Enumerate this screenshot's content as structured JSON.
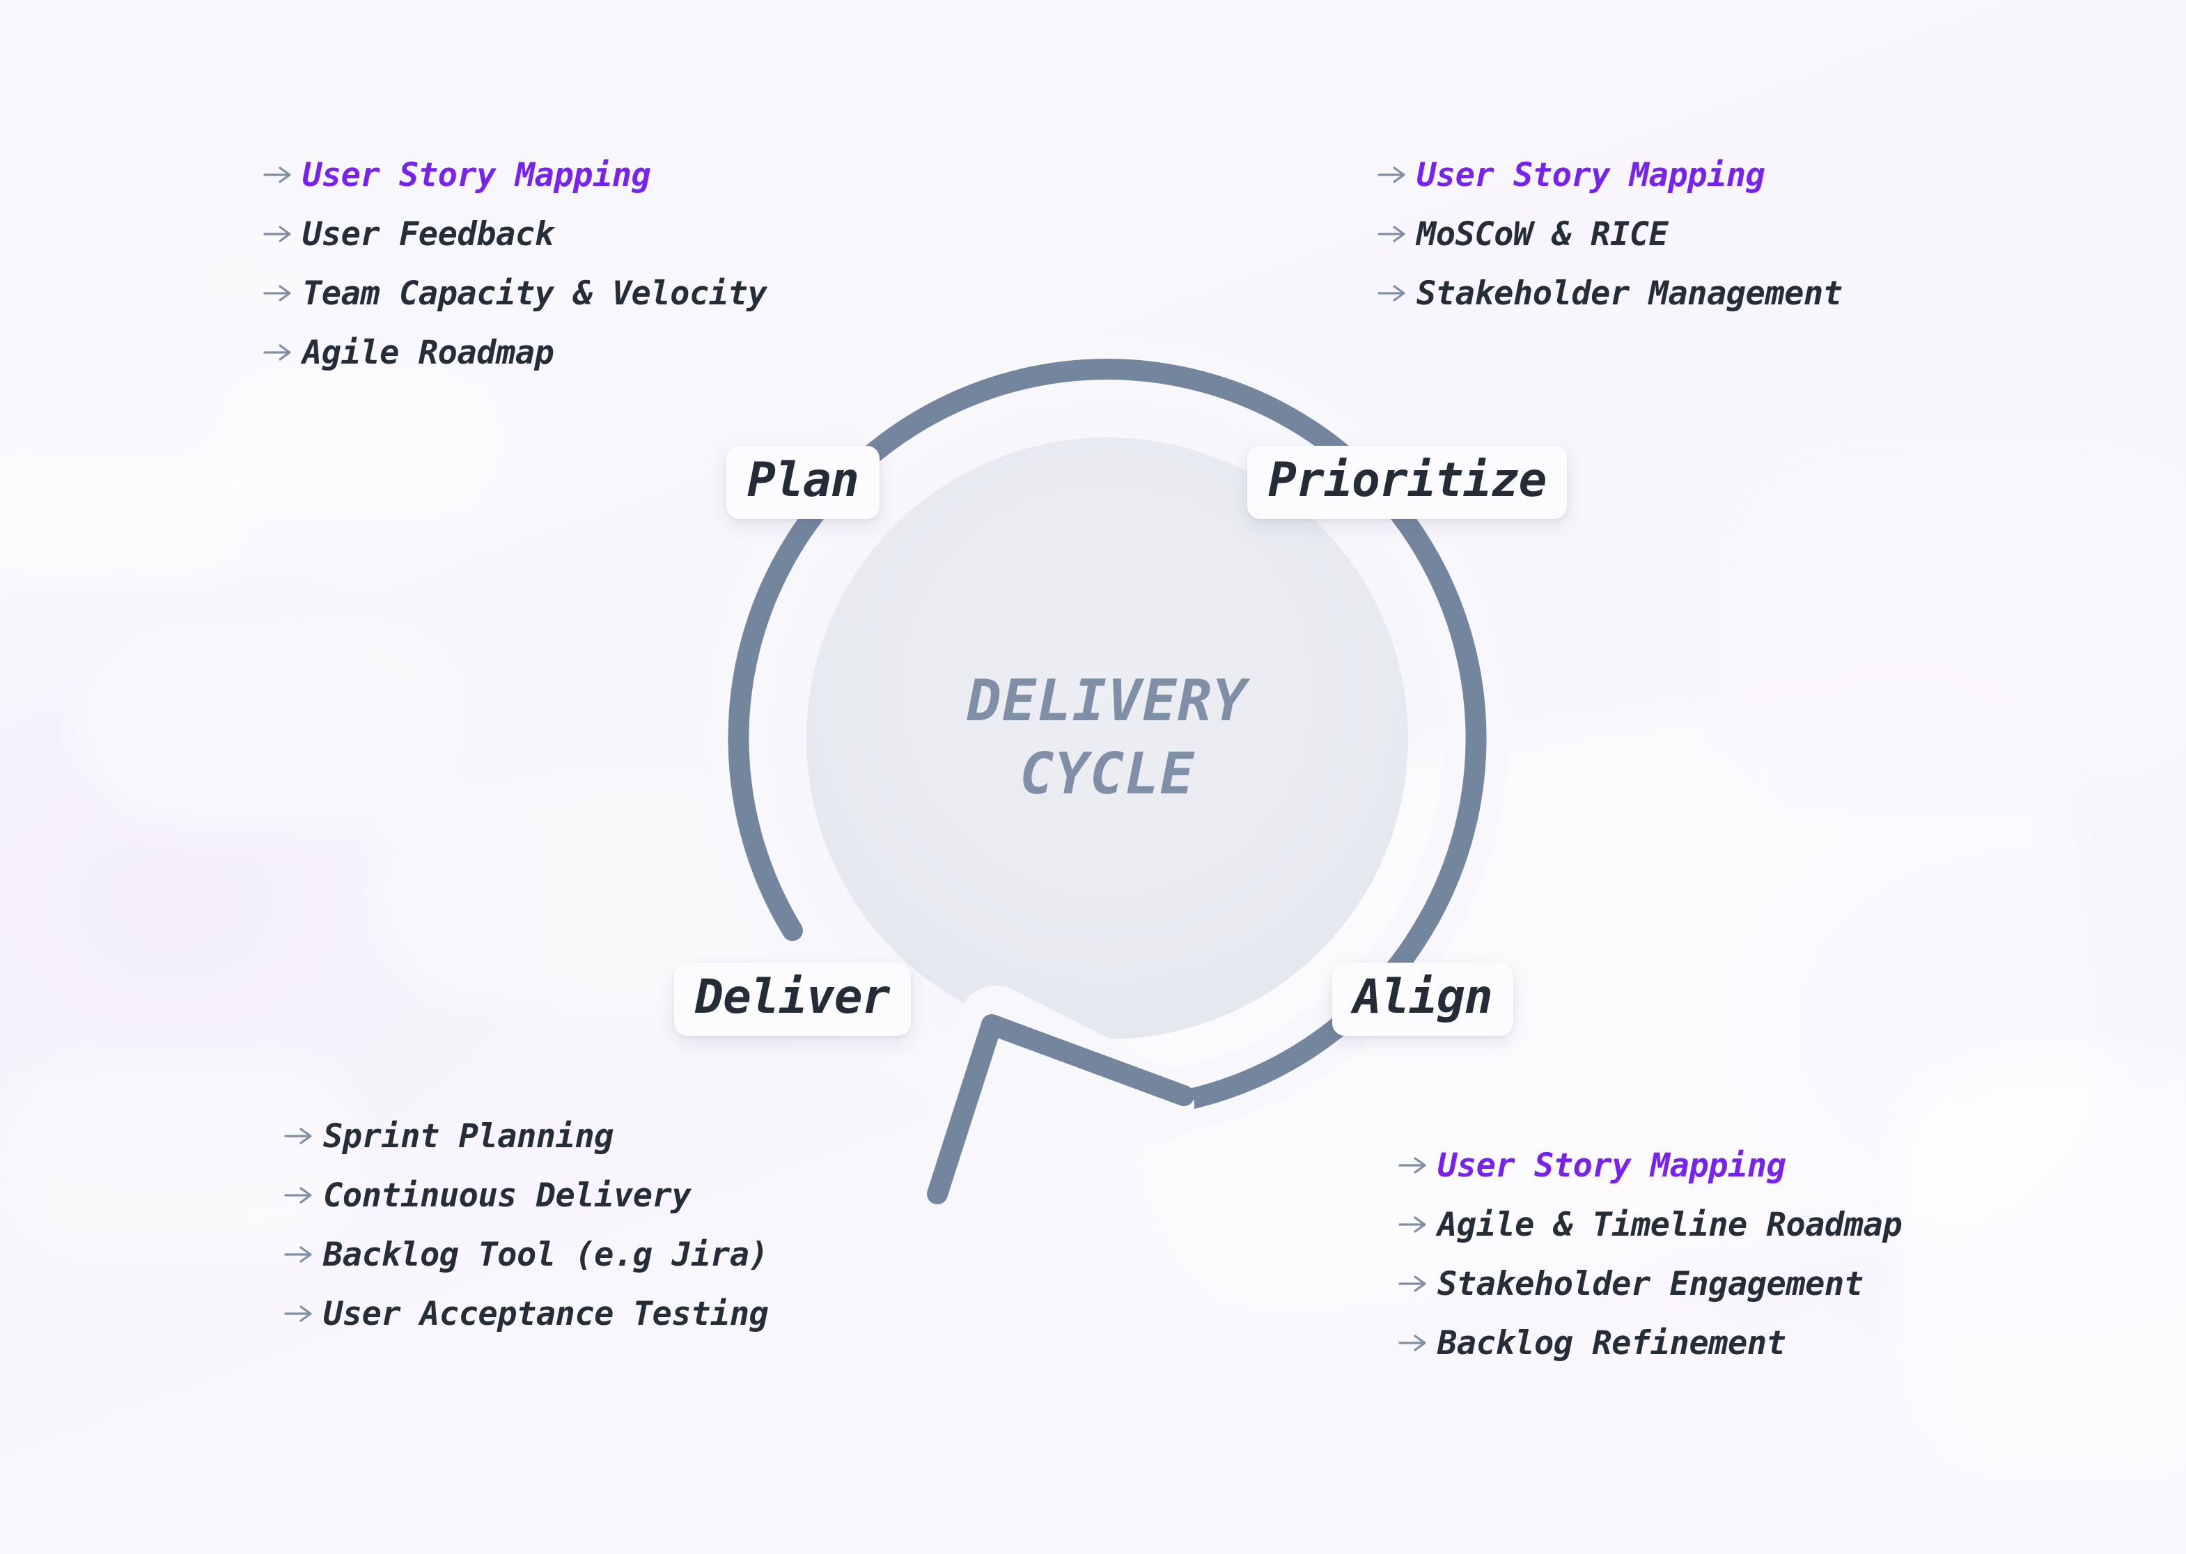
{
  "theme": {
    "background": "#f8f7fc",
    "accent_purple": "#7722ee",
    "ring_blue": "#74869e",
    "text_dark": "#252d38",
    "center_text": "#7e8fa6",
    "chip_bg": "#fcfbfd"
  },
  "cycle": {
    "center_line1": "DELIVERY",
    "center_line2": "CYCLE",
    "stages": [
      {
        "id": "plan",
        "label": "Plan"
      },
      {
        "id": "prioritize",
        "label": "Prioritize"
      },
      {
        "id": "align",
        "label": "Align"
      },
      {
        "id": "deliver",
        "label": "Deliver"
      }
    ]
  },
  "lists": {
    "top_left": {
      "stage": "Plan",
      "items": [
        {
          "label": "User Story Mapping",
          "accent": true,
          "icon": "arrow-right-icon"
        },
        {
          "label": "User Feedback",
          "accent": false,
          "icon": "arrow-right-icon"
        },
        {
          "label": "Team Capacity & Velocity",
          "accent": false,
          "icon": "arrow-right-icon"
        },
        {
          "label": "Agile Roadmap",
          "accent": false,
          "icon": "arrow-right-icon"
        }
      ]
    },
    "top_right": {
      "stage": "Prioritize",
      "items": [
        {
          "label": "User Story Mapping",
          "accent": true,
          "icon": "arrow-right-icon"
        },
        {
          "label": "MoSCoW & RICE",
          "accent": false,
          "icon": "arrow-right-icon"
        },
        {
          "label": "Stakeholder Management",
          "accent": false,
          "icon": "arrow-right-icon"
        }
      ]
    },
    "bottom_left": {
      "stage": "Deliver",
      "items": [
        {
          "label": "Sprint Planning",
          "accent": false,
          "icon": "arrow-right-icon"
        },
        {
          "label": "Continuous Delivery",
          "accent": false,
          "icon": "arrow-right-icon"
        },
        {
          "label": "Backlog Tool (e.g Jira)",
          "accent": false,
          "icon": "arrow-right-icon"
        },
        {
          "label": "User Acceptance Testing",
          "accent": false,
          "icon": "arrow-right-icon"
        }
      ]
    },
    "bottom_right": {
      "stage": "Align",
      "items": [
        {
          "label": "User Story Mapping",
          "accent": true,
          "icon": "arrow-right-icon"
        },
        {
          "label": "Agile & Timeline Roadmap",
          "accent": false,
          "icon": "arrow-right-icon"
        },
        {
          "label": "Stakeholder Engagement",
          "accent": false,
          "icon": "arrow-right-icon"
        },
        {
          "label": "Backlog Refinement",
          "accent": false,
          "icon": "arrow-right-icon"
        }
      ]
    }
  }
}
